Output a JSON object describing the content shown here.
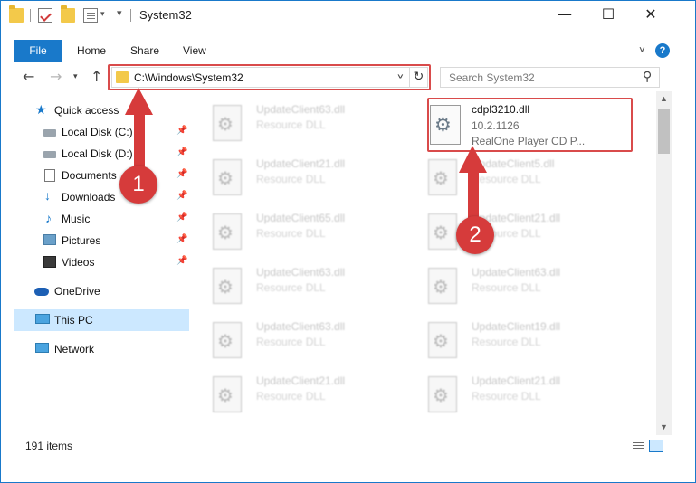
{
  "window": {
    "title": "System32",
    "controls": {
      "minimize": "—",
      "maximize": "☐",
      "close": "✕"
    }
  },
  "ribbon": {
    "file": "File",
    "tabs": [
      "Home",
      "Share",
      "View"
    ]
  },
  "address": {
    "path": "C:\\Windows\\System32",
    "search_placeholder": "Search System32"
  },
  "sidebar": {
    "items": [
      {
        "label": "Quick access",
        "icon": "star-icon"
      },
      {
        "label": "Local Disk (C:)",
        "icon": "disk-icon",
        "pinned": true
      },
      {
        "label": "Local Disk (D:)",
        "icon": "disk-icon",
        "pinned": true
      },
      {
        "label": "Documents",
        "icon": "document-icon",
        "pinned": true
      },
      {
        "label": "Downloads",
        "icon": "download-icon",
        "pinned": true
      },
      {
        "label": "Music",
        "icon": "music-icon",
        "pinned": true
      },
      {
        "label": "Pictures",
        "icon": "pictures-icon",
        "pinned": true
      },
      {
        "label": "Videos",
        "icon": "videos-icon",
        "pinned": true
      },
      {
        "label": "OneDrive",
        "icon": "cloud-icon"
      },
      {
        "label": "This PC",
        "icon": "computer-icon",
        "selected": true
      },
      {
        "label": "Network",
        "icon": "network-icon"
      }
    ]
  },
  "files": {
    "target": {
      "name": "cdpl3210.dll",
      "version": "10.2.1126",
      "description": "RealOne Player CD P..."
    },
    "left_column": [
      {
        "name": "UpdateClient63.dll",
        "type": "Resource DLL"
      },
      {
        "name": "UpdateClient21.dll",
        "type": "Resource DLL"
      },
      {
        "name": "UpdateClient65.dll",
        "type": "Resource DLL"
      },
      {
        "name": "UpdateClient63.dll",
        "type": "Resource DLL"
      },
      {
        "name": "UpdateClient63.dll",
        "type": "Resource DLL"
      },
      {
        "name": "UpdateClient21.dll",
        "type": "Resource DLL"
      }
    ],
    "right_column": [
      {
        "name": "UpdateClient5.dll",
        "type": "Resource DLL"
      },
      {
        "name": "UpdateClient21.dll",
        "type": "Resource DLL"
      },
      {
        "name": "UpdateClient63.dll",
        "type": "Resource DLL"
      },
      {
        "name": "UpdateClient19.dll",
        "type": "Resource DLL"
      },
      {
        "name": "UpdateClient21.dll",
        "type": "Resource DLL"
      }
    ]
  },
  "status": {
    "item_count": "191 items"
  },
  "annotations": {
    "step1": "1",
    "step2": "2",
    "color": "#d63b3b"
  }
}
